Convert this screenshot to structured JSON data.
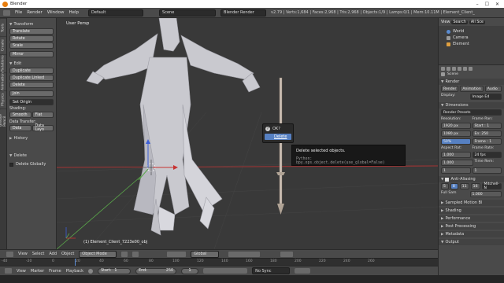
{
  "window": {
    "title": "Blender"
  },
  "menubar": {
    "items": [
      "File",
      "Render",
      "Window",
      "Help"
    ],
    "layout_value": "Default",
    "scene_value": "Scene",
    "render_engine": "Blender Render",
    "stats": "v2.79 | Verts:1,684 | Faces:2,968 | Tris:2,968 | Objects:1/9 | Lamps:0/1 | Mem:10.11M | Element_Client_"
  },
  "left_tabs": [
    "Tools",
    "Create",
    "Relations",
    "Animation",
    "Physics",
    "Grease Pencil"
  ],
  "toolshelf": {
    "transform_header": "Transform",
    "transform_buttons": [
      "Translate",
      "Rotate",
      "Scale",
      "Mirror"
    ],
    "edit_header": "Edit",
    "edit_buttons": [
      "Duplicate",
      "Duplicate Linked",
      "Delete",
      "Join"
    ],
    "set_origin": "Set Origin",
    "shading_label": "Shading:",
    "smooth": "Smooth",
    "flat": "Flat",
    "data_transfer_label": "Data Transfer:",
    "data": "Data",
    "data_layout": "Data Layo",
    "history_header": "History",
    "delete_header": "Delete",
    "delete_globally": "Delete Globally"
  },
  "viewport": {
    "view_label": "User Persp",
    "object_label": "(1) Element_Client_7223e00_obj"
  },
  "popup": {
    "ok_label": "OK?",
    "delete_label": "Delete"
  },
  "tooltip": {
    "description": "Delete selected objects.",
    "python": "Python: bpy.ops.object.delete(use_global=False)"
  },
  "viewport_header": {
    "items": [
      "View",
      "Select",
      "Add",
      "Object"
    ],
    "mode": "Object Mode",
    "orientation": "Global"
  },
  "ruler_ticks": [
    "-40",
    "-20",
    "0",
    "20",
    "40",
    "60",
    "80",
    "100",
    "120",
    "140",
    "160",
    "180",
    "200",
    "220",
    "240",
    "260"
  ],
  "timeline": {
    "items": [
      "View",
      "Marker",
      "Frame",
      "Playback"
    ],
    "start_label": "Start:",
    "start_value": "1",
    "end_label": "End:",
    "end_value": "250",
    "current_frame": "1",
    "sync": "No Sync"
  },
  "outliner": {
    "view": "View",
    "search": "Search",
    "scope": "All Sce",
    "items": [
      "World",
      "Camera",
      "Element"
    ]
  },
  "properties": {
    "scene_label": "Scene",
    "render_header": "Render",
    "render_buttons": [
      "Render",
      "Animation",
      "Audio"
    ],
    "display_label": "Display:",
    "display_value": "Image Ed",
    "dimensions_header": "Dimensions",
    "render_presets": "Render Presets",
    "resolution_label": "Resolution:",
    "res_x": "1920 px",
    "res_y": "1080 px",
    "res_pct": "50%",
    "frame_range_label": "Frame Ran:",
    "frame_start": "Start : 1",
    "frame_end": "En: 250",
    "frame_step": "Frame : 1",
    "aspect_label": "Aspect Rat:",
    "aspect_x": "1.000",
    "aspect_y": "1.000",
    "frame_rate_label": "Frame Rate:",
    "frame_rate": "24 fps",
    "time_rem_label": "Time Rem:",
    "time_rem_a": "1",
    "time_rem_b": "1",
    "aa_header": "Anti-Aliasing",
    "aa_samples": [
      "5",
      "8",
      "11",
      "16"
    ],
    "aa_filter": "Mitchell-N",
    "full_sample": "Full Sam",
    "aa_size": "1.000",
    "sections": [
      "Sampled Motion Bl",
      "Shading",
      "Performance",
      "Post Processing",
      "Metadata",
      "Output"
    ]
  },
  "colors": {
    "accent_blue": "#5680c2",
    "axis_red": "#c83232",
    "axis_green": "#5aa64a",
    "axis_blue": "#3c5fd8",
    "model_grey": "#c9c9cf"
  }
}
